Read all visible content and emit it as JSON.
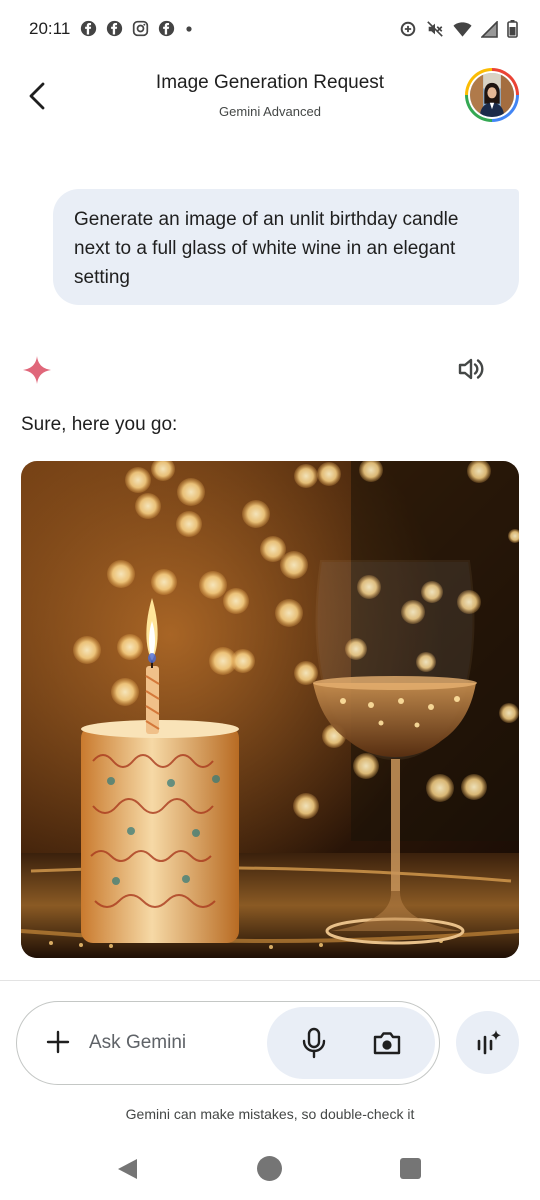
{
  "status_bar": {
    "time": "20:11",
    "left_icons": [
      "facebook-icon",
      "facebook-icon",
      "instagram-icon",
      "facebook-icon",
      "dot-icon"
    ],
    "right_icons": [
      "data-saver-icon",
      "mute-icon",
      "wifi-icon",
      "signal-icon",
      "battery-icon"
    ]
  },
  "header": {
    "title": "Image Generation Request",
    "subtitle": "Gemini Advanced"
  },
  "conversation": {
    "user_message": "Generate an image of an unlit birthday candle next to a full glass of white wine in an elegant setting",
    "response_text": "Sure, here you go:"
  },
  "input": {
    "placeholder": "Ask Gemini"
  },
  "disclaimer": "Gemini can make mistakes, so double-check it",
  "colors": {
    "bubble": "#e9eef6",
    "spark": "#e8677a",
    "icon": "#444746"
  }
}
